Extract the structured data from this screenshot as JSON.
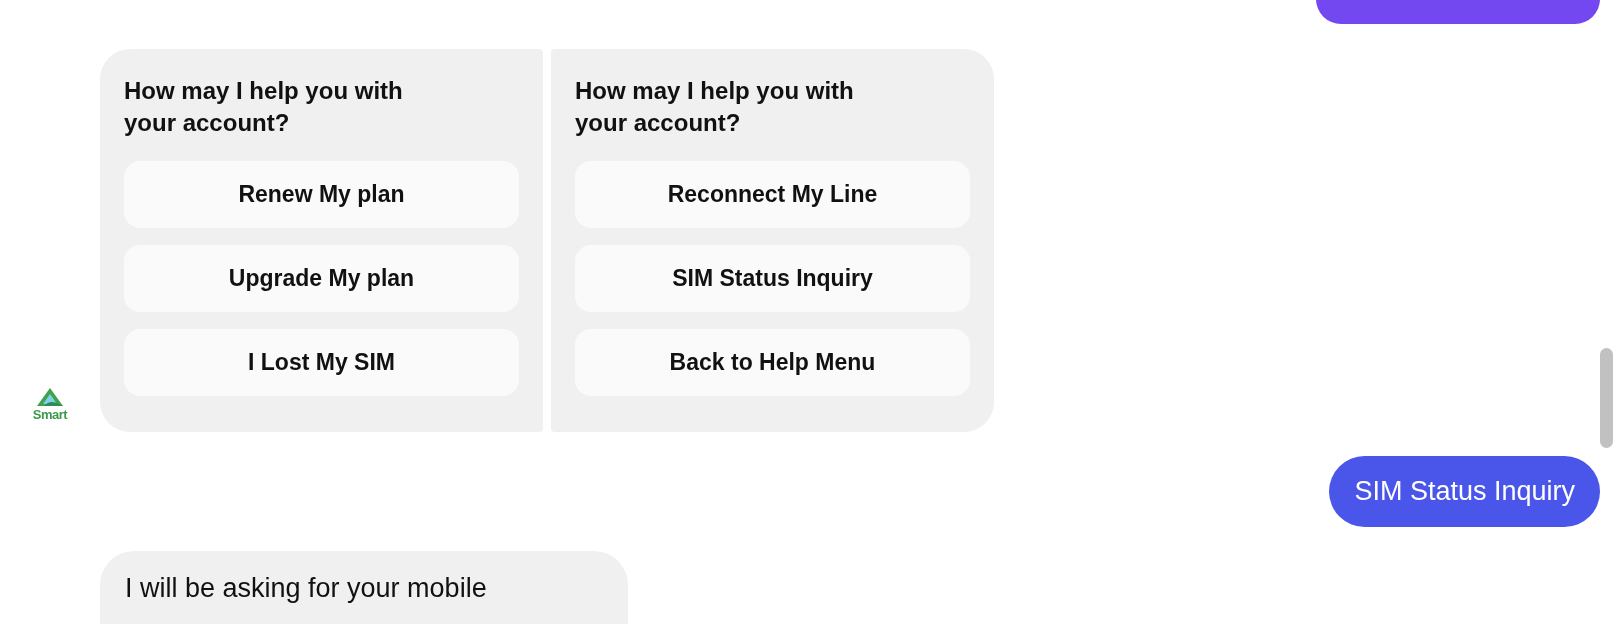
{
  "bot_name": "Smart",
  "menu_cards": [
    {
      "title": "How may I help you with your account?",
      "options": [
        "Renew My plan",
        "Upgrade My plan",
        "I Lost My SIM"
      ]
    },
    {
      "title": "How may I help you with your account?",
      "options": [
        "Reconnect My Line",
        "SIM Status Inquiry",
        "Back to Help Menu"
      ]
    }
  ],
  "user_message": "SIM Status Inquiry",
  "bot_message": "I will be asking for your mobile"
}
